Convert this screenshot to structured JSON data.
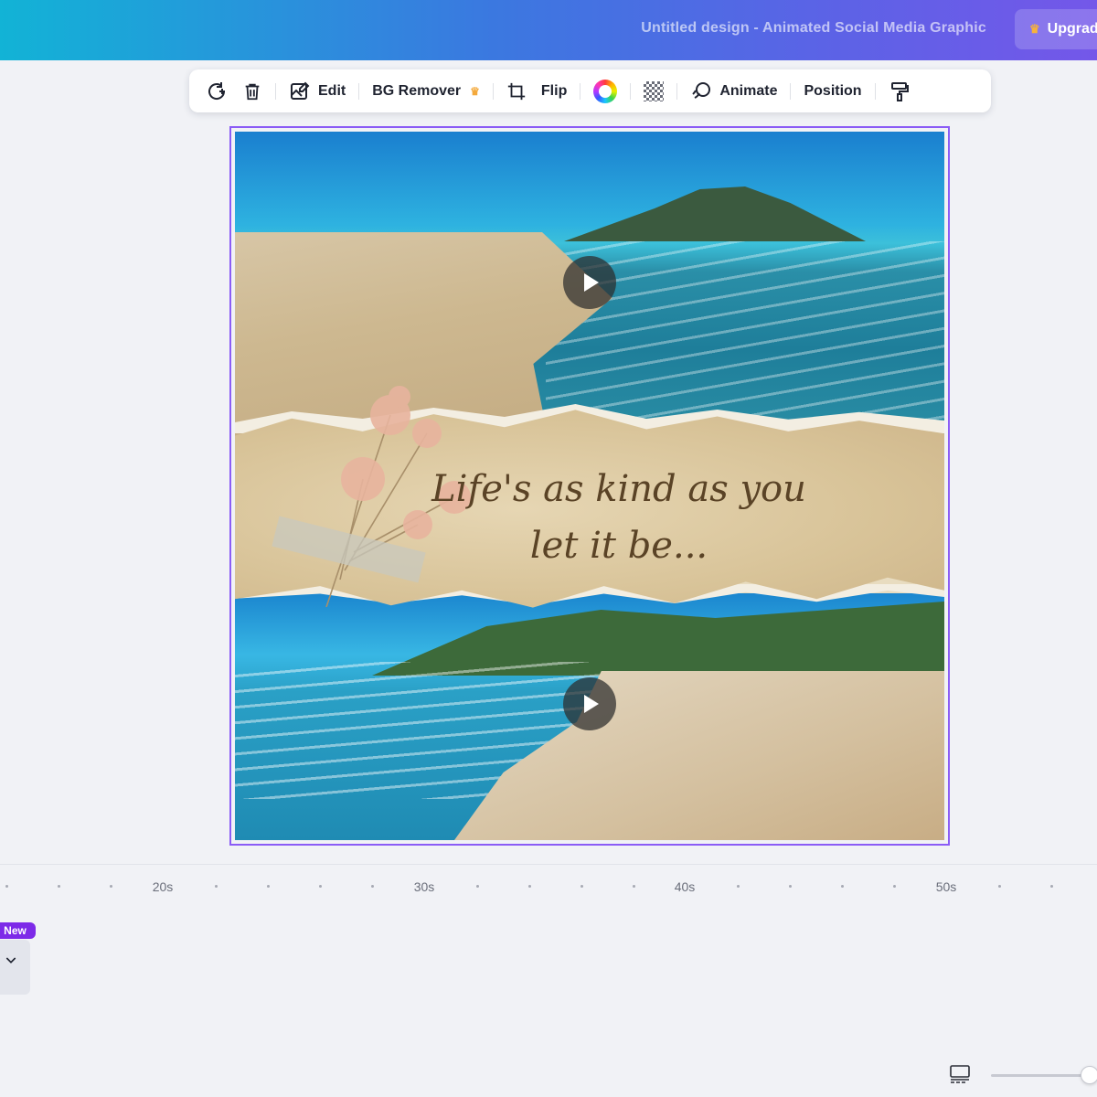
{
  "header": {
    "doc_title": "Untitled design - Animated Social Media Graphic",
    "upgrade_label": "Upgrad",
    "upgrade_icon": "crown-icon"
  },
  "toolbar": {
    "items": [
      {
        "name": "replace",
        "icon": "replace-icon"
      },
      {
        "name": "delete",
        "icon": "trash-icon"
      },
      {
        "name": "edit",
        "icon": "edit-image-icon",
        "label": "Edit"
      },
      {
        "name": "bg-remover",
        "label": "BG Remover",
        "icon": "crown-icon"
      },
      {
        "name": "crop",
        "icon": "crop-icon"
      },
      {
        "name": "flip",
        "label": "Flip"
      },
      {
        "name": "color",
        "icon": "color-wheel-icon"
      },
      {
        "name": "transparency",
        "icon": "transparency-icon"
      },
      {
        "name": "animate",
        "label": "Animate",
        "icon": "animate-icon"
      },
      {
        "name": "position",
        "label": "Position"
      },
      {
        "name": "copy-style",
        "icon": "paint-roller-icon"
      }
    ]
  },
  "canvas": {
    "text_line1": "Life's as kind as you",
    "text_line2": "let it be...",
    "videos": [
      {
        "name": "top-beach-video",
        "icon": "play-icon"
      },
      {
        "name": "bottom-beach-video",
        "icon": "play-icon"
      }
    ]
  },
  "timeline": {
    "ticks": [
      "20s",
      "30s",
      "40s",
      "50s"
    ],
    "badge": "New",
    "chevron_icon": "chevron-down-icon"
  },
  "footer": {
    "grid_view_icon": "grid-view-icon",
    "zoom_slider_icon": "zoom-slider"
  },
  "colors": {
    "header_gradient_start": "#12b3d6",
    "header_gradient_end": "#7457e9",
    "selection": "#8b5cf6",
    "badge": "#7d2ae8"
  }
}
